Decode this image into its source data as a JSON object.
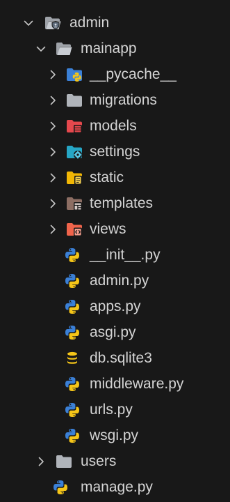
{
  "explorer": {
    "root": {
      "label": "admin",
      "expanded": true,
      "icon": "admin-folder-icon"
    },
    "mainapp": {
      "label": "mainapp",
      "expanded": true,
      "icon": "folder-open-icon"
    },
    "mainapp_items": [
      {
        "label": "__pycache__",
        "type": "folder",
        "icon": "python-folder-icon"
      },
      {
        "label": "migrations",
        "type": "folder",
        "icon": "folder-icon"
      },
      {
        "label": "models",
        "type": "folder",
        "icon": "models-folder-icon"
      },
      {
        "label": "settings",
        "type": "folder",
        "icon": "settings-folder-icon"
      },
      {
        "label": "static",
        "type": "folder",
        "icon": "static-folder-icon"
      },
      {
        "label": "templates",
        "type": "folder",
        "icon": "templates-folder-icon"
      },
      {
        "label": "views",
        "type": "folder",
        "icon": "views-folder-icon"
      },
      {
        "label": "__init__.py",
        "type": "file",
        "icon": "python-file-icon"
      },
      {
        "label": "admin.py",
        "type": "file",
        "icon": "python-file-icon"
      },
      {
        "label": "apps.py",
        "type": "file",
        "icon": "python-file-icon"
      },
      {
        "label": "asgi.py",
        "type": "file",
        "icon": "python-file-icon"
      },
      {
        "label": "db.sqlite3",
        "type": "file",
        "icon": "database-icon"
      },
      {
        "label": "middleware.py",
        "type": "file",
        "icon": "python-file-icon"
      },
      {
        "label": "urls.py",
        "type": "file",
        "icon": "python-file-icon"
      },
      {
        "label": "wsgi.py",
        "type": "file",
        "icon": "python-file-icon"
      }
    ],
    "users": {
      "label": "users",
      "expanded": false,
      "icon": "folder-icon"
    },
    "manage": {
      "label": "manage.py",
      "icon": "python-file-icon"
    }
  },
  "colors": {
    "background": "#181818",
    "text": "#d4d4d4",
    "chevron": "#c5c5c5",
    "python_blue": "#3b80d6",
    "python_yellow": "#f5c518",
    "models_red": "#e5484d",
    "settings_teal": "#26a6c5",
    "static_yellow": "#f2b705",
    "templates_brown": "#8d6e63",
    "views_orange": "#f0644b",
    "folder_gray": "#b0b4ba"
  }
}
